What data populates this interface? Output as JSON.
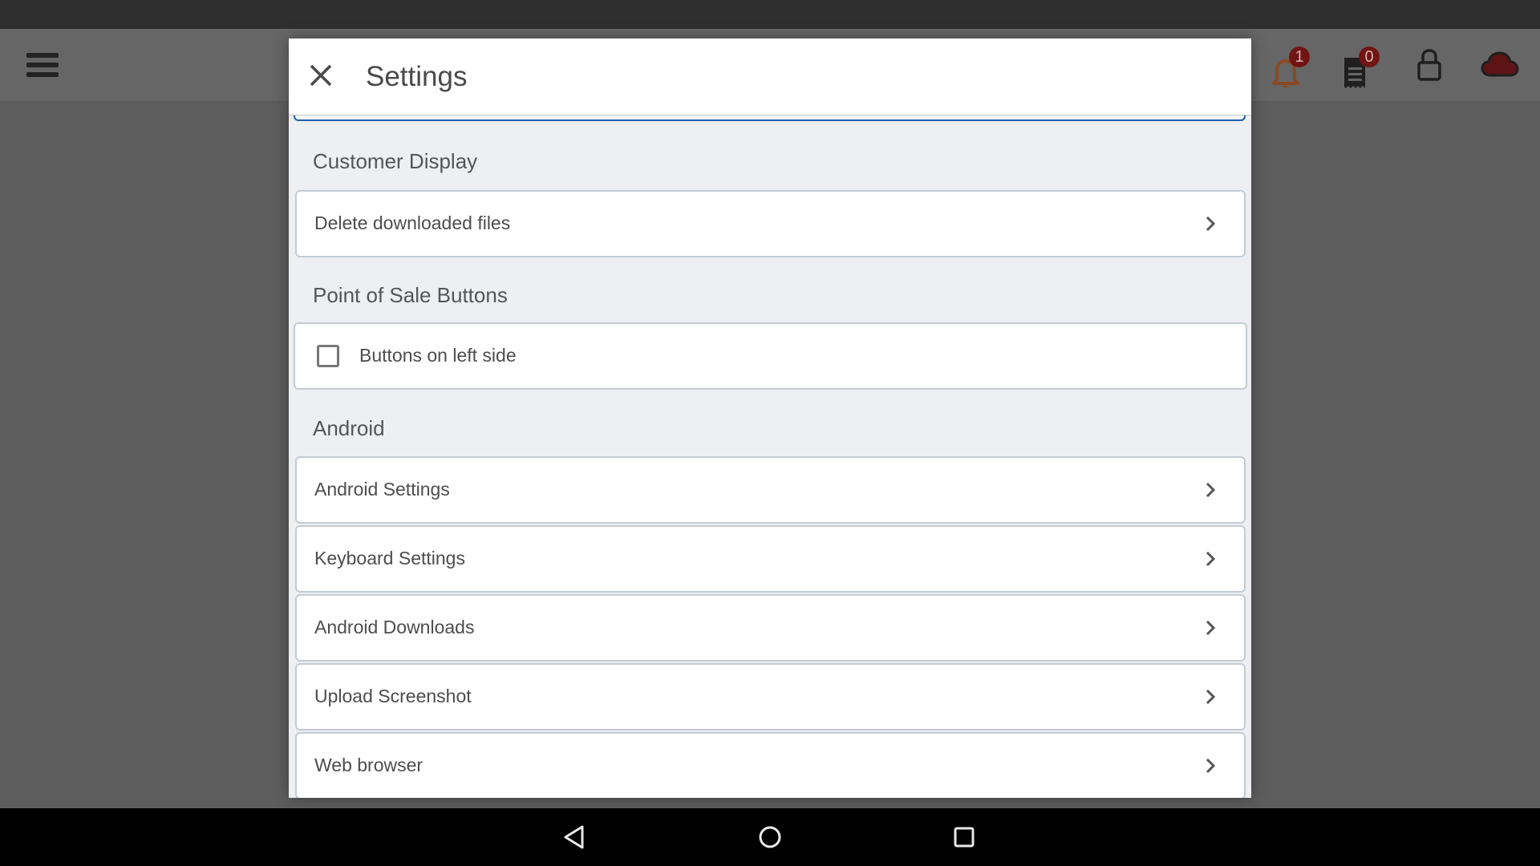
{
  "app_header": {
    "menu_icon": "hamburger-menu-icon",
    "icons": [
      {
        "name": "notifications",
        "icon": "bell-icon",
        "badge": "1",
        "color": "#8a4a22"
      },
      {
        "name": "receipts",
        "icon": "receipt-icon",
        "badge": "0",
        "color": "#1f1f1f"
      },
      {
        "name": "lock",
        "icon": "lock-icon",
        "color": "#1f1f1f"
      },
      {
        "name": "cloud-sync",
        "icon": "cloud-icon",
        "color": "#5e1414"
      }
    ],
    "badge_color": "#701414"
  },
  "modal": {
    "title": "Settings",
    "close_icon": "close-icon",
    "accent_color": "#1f62ad",
    "sections": [
      {
        "title": "Customer Display",
        "items": [
          {
            "label": "Delete downloaded files",
            "type": "link"
          }
        ]
      },
      {
        "title": "Point of Sale Buttons",
        "items": [
          {
            "label": "Buttons on left side",
            "type": "checkbox",
            "checked": false
          }
        ]
      },
      {
        "title": "Android",
        "items": [
          {
            "label": "Android Settings",
            "type": "link"
          },
          {
            "label": "Keyboard Settings",
            "type": "link"
          },
          {
            "label": "Android Downloads",
            "type": "link"
          },
          {
            "label": "Upload Screenshot",
            "type": "link"
          },
          {
            "label": "Web browser",
            "type": "link"
          }
        ]
      }
    ]
  },
  "nav_bar": {
    "buttons": [
      {
        "name": "back",
        "icon": "back-triangle-icon"
      },
      {
        "name": "home",
        "icon": "home-circle-icon"
      },
      {
        "name": "recents",
        "icon": "recents-square-icon"
      }
    ]
  }
}
